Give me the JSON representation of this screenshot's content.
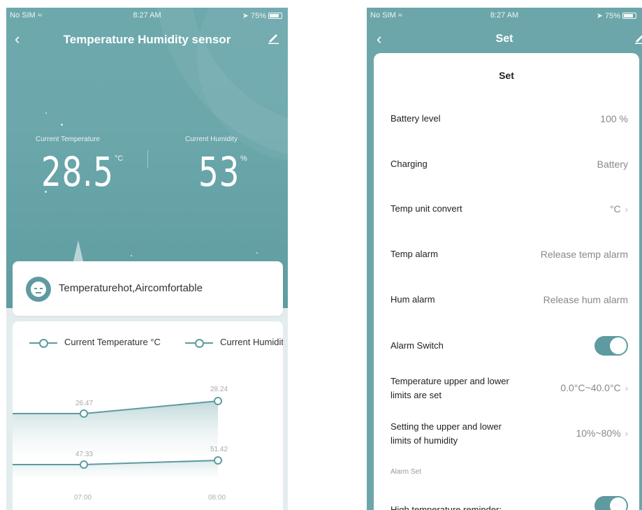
{
  "left": {
    "status": {
      "carrier": "No SIM",
      "time": "8:27 AM",
      "battery": "75%"
    },
    "nav": {
      "title": "Temperature Humidity sensor"
    },
    "temperature": {
      "label": "Current Temperature",
      "value": "28.5",
      "unit": "°C"
    },
    "humidity": {
      "label": "Current Humidity",
      "value": "53",
      "unit": "%"
    },
    "comfort": {
      "text": "Temperaturehot,Aircomfortable"
    },
    "chart": {
      "legend": [
        "Current Temperature °C",
        "Current Humidit"
      ],
      "x_labels": [
        "07:00",
        "08:00"
      ],
      "series": [
        {
          "name": "Current Temperature °C",
          "values": [
            "26.47",
            "28.24"
          ]
        },
        {
          "name": "Current Humidit",
          "values": [
            "47.33",
            "51.42"
          ]
        }
      ]
    }
  },
  "right": {
    "status": {
      "carrier": "No SIM",
      "time": "8:27 AM",
      "battery": "75%"
    },
    "nav": {
      "title": "Set"
    },
    "card_title": "Set",
    "rows": [
      {
        "label": "Battery level",
        "value": "100 %"
      },
      {
        "label": "Charging",
        "value": "Battery"
      },
      {
        "label": "Temp unit convert",
        "value": "°C"
      },
      {
        "label": "Temp alarm",
        "value": "Release temp alarm"
      },
      {
        "label": "Hum alarm",
        "value": "Release hum alarm"
      },
      {
        "label": "Alarm Switch"
      },
      {
        "label_line1": "Temperature upper and lower",
        "label_line2": "limits are set",
        "value": "0.0°C~40.0°C"
      },
      {
        "label_line1": "Setting the upper and lower",
        "label_line2": "limits of humidity",
        "value": "10%~80%"
      }
    ],
    "section": "Alarm Set",
    "last_row": {
      "label": "High temperature reminder:"
    },
    "toggles": {
      "alarm_switch": "on",
      "high_temp_reminder": "on"
    }
  },
  "colors": {
    "accent": "#5e9ba0",
    "header": "#6ca6aa"
  },
  "icons": {
    "back": "chevron-left-icon",
    "edit": "pencil-icon",
    "wifi": "wifi-icon",
    "battery": "battery-icon",
    "face": "face-icon",
    "chevron": "chevron-right-icon"
  }
}
